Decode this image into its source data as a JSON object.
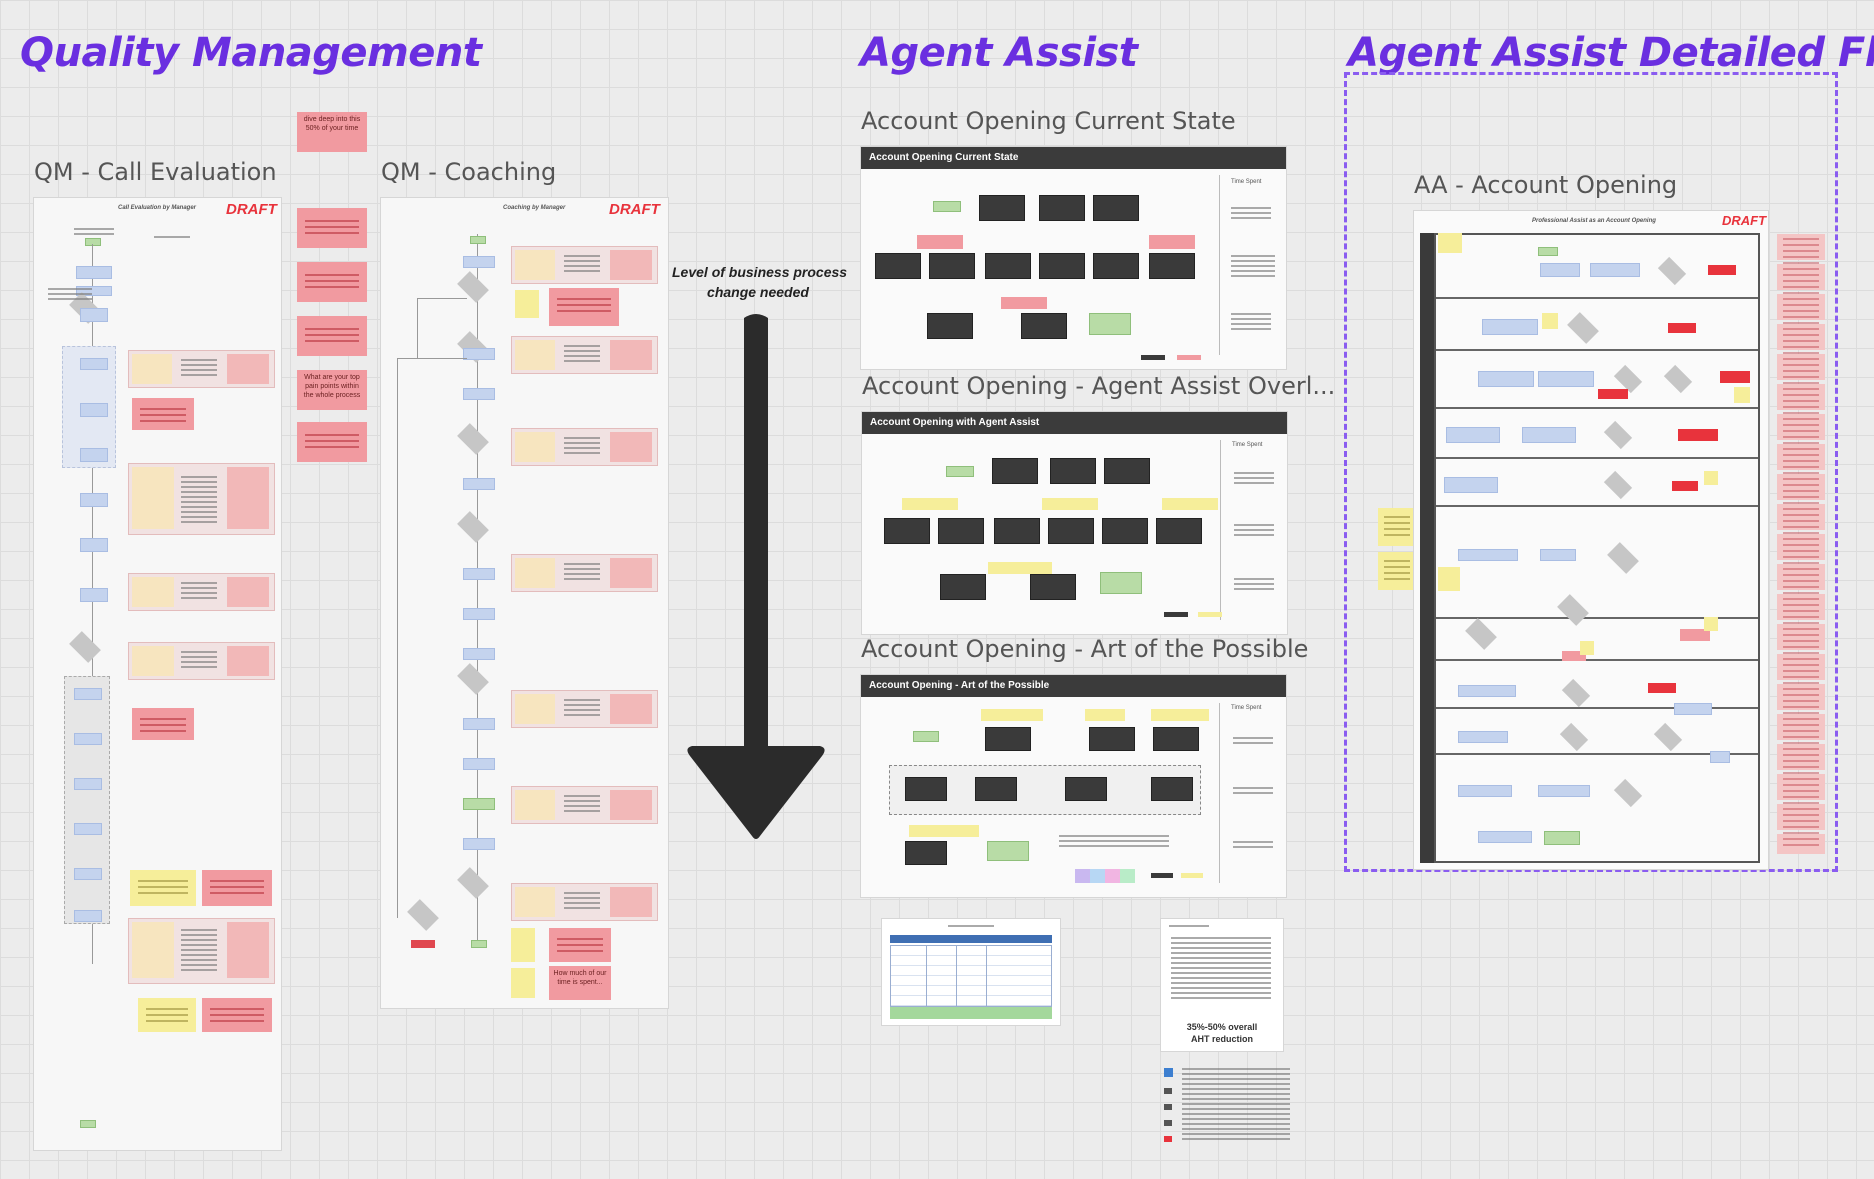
{
  "sections": {
    "qm_title": "Quality Management",
    "aa_title": "Agent Assist",
    "aa_detail_title": "Agent Assist Detailed Flow"
  },
  "frames": {
    "qm_call_eval": "QM - Call Evaluation",
    "qm_coaching": "QM - Coaching",
    "ao_current": "Account Opening Current State",
    "ao_overlay": "Account Opening - Agent Assist Overl...",
    "ao_possible": "Account Opening - Art of the Possible",
    "aa_account_opening": "AA - Account Opening"
  },
  "boards": {
    "draft": "DRAFT",
    "call_eval_header": "Call Evaluation by Manager",
    "coaching_header": "Coaching by Manager",
    "ao_current_header": "Account Opening Current State",
    "ao_overlay_header": "Account Opening with Agent Assist",
    "ao_possible_header": "Account Opening - Art of the Possible",
    "time_spent": "Time Spent",
    "detail_header": "Professional Assist as an Account Opening"
  },
  "annotations": {
    "arrow_note_line1": "Level of business process",
    "arrow_note_line2": "change needed",
    "stat_line1": "35%-50% overall",
    "stat_line2": "AHT reduction"
  },
  "stickies": {
    "dive_deep": "dive deep into this 50% of your time",
    "pain_points": "What are your top pain points within the whole process",
    "how_much": "How much of our time is spent..."
  },
  "colors": {
    "title": "#6a2fe0",
    "draft": "#e8333c",
    "dashed_border": "#8a5cf0",
    "arrow": "#2b2b2b"
  }
}
